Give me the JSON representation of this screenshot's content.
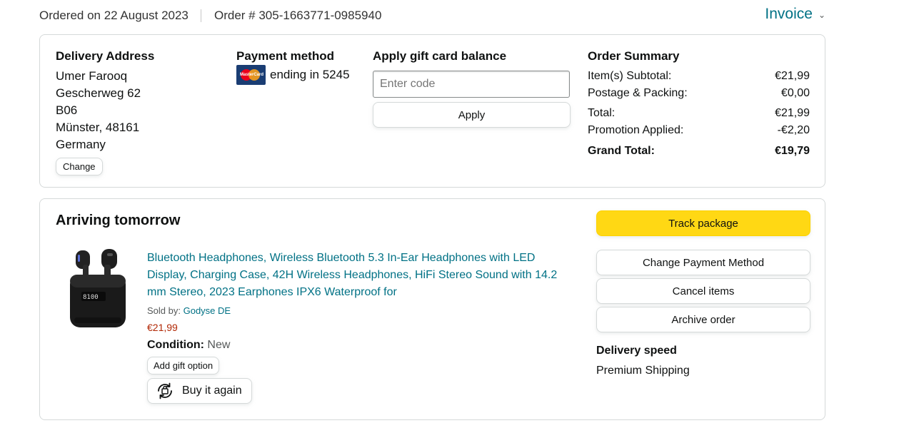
{
  "header": {
    "ordered_on": "Ordered on 22 August 2023",
    "order_number": "Order # 305-1663771-0985940",
    "invoice_label": "Invoice"
  },
  "delivery_address": {
    "heading": "Delivery Address",
    "name": "Umer Farooq",
    "street": "Gescherweg 62",
    "unit": "B06",
    "city": "Münster, 48161",
    "country": "Germany",
    "change_label": "Change"
  },
  "payment": {
    "heading": "Payment method",
    "card_brand": "MasterCard",
    "ending_text": "ending in 5245"
  },
  "gift_card": {
    "heading": "Apply gift card balance",
    "placeholder": "Enter code",
    "apply_label": "Apply"
  },
  "order_summary": {
    "heading": "Order Summary",
    "rows": [
      {
        "label": "Item(s) Subtotal:",
        "value": "€21,99"
      },
      {
        "label": "Postage & Packing:",
        "value": "€0,00"
      },
      {
        "label": "Total:",
        "value": "€21,99"
      },
      {
        "label": "Promotion Applied:",
        "value": "-€2,20"
      }
    ],
    "grand_total_label": "Grand Total:",
    "grand_total_value": "€19,79"
  },
  "shipment": {
    "status": "Arriving tomorrow",
    "product": {
      "title": "Bluetooth Headphones, Wireless Bluetooth 5.3 In-Ear Headphones with LED Display, Charging Case, 42H Wireless Headphones, HiFi Stereo Sound with 14.2 mm Stereo, 2023 Earphones IPX6 Waterproof for",
      "sold_by_label": "Sold by:",
      "seller": "Godyse DE",
      "price": "€21,99",
      "condition_label": "Condition:",
      "condition_value": "New",
      "add_gift_label": "Add gift option",
      "buy_again_label": "Buy it again",
      "case_display": "8100"
    },
    "actions": {
      "track": "Track package",
      "change_payment": "Change Payment Method",
      "cancel": "Cancel items",
      "archive": "Archive order"
    },
    "delivery_speed_label": "Delivery speed",
    "delivery_speed_value": "Premium Shipping"
  },
  "colors": {
    "link": "#007185",
    "price": "#B12704",
    "primary_button": "#FFD814",
    "border": "#D5D9D9"
  }
}
